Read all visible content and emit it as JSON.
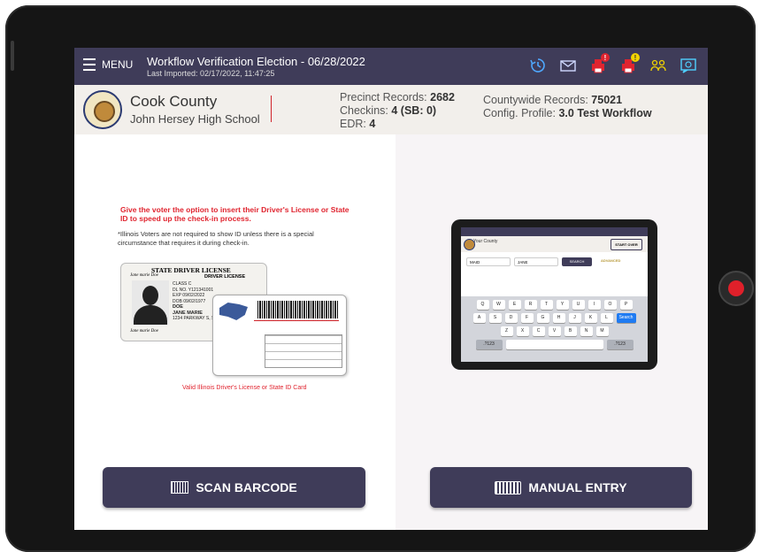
{
  "topbar": {
    "menu_label": "MENU",
    "title": "Workflow Verification Election - 06/28/2022",
    "last_imported": "Last Imported: 02/17/2022, 11:47:25",
    "alert_badge": "!",
    "warning_badge": "!"
  },
  "header": {
    "county": "Cook County",
    "location": "John Hersey High School",
    "precinct_label": "Precinct Records:",
    "precinct_value": "2682",
    "checkins_label": "Checkins:",
    "checkins_value": "4 (SB: 0)",
    "edr_label": "EDR:",
    "edr_value": "4",
    "countywide_label": "Countywide Records:",
    "countywide_value": "75021",
    "config_label": "Config. Profile:",
    "config_value": "3.0 Test Workflow"
  },
  "left_panel": {
    "instruction": "Give the voter the option to insert their Driver's License or State ID to speed up the check-in process.",
    "note": "*Illinois Voters are not required to show ID unless there is a special circumstance that requires it during check-in.",
    "card_title": "STATE DRIVER LICENSE",
    "card_subtitle": "DRIVER LICENSE",
    "card_signature": "Jane marie Doe",
    "card_id": "DL NO. Y121341001",
    "card_class": "CLASS C",
    "card_exp": "EXP 09/02/2022",
    "card_dob": "DOB 09/02/1977",
    "card_lastname": "DOE",
    "card_name": "JANE MARIE",
    "card_address": "1234 PARKWAY S, ST. CITY, STATE 12345",
    "caption": "Valid Illinois Driver's License or State ID Card",
    "scan_button": "SCAN BARCODE"
  },
  "right_panel": {
    "tablet_title": "Your County",
    "tablet_start": "START OVER",
    "tablet_last_field": "MAID",
    "tablet_first_field": "JANE",
    "tablet_search": "SEARCH",
    "tablet_advanced": "ADVANCED",
    "keyboard_row1": [
      "Q",
      "W",
      "E",
      "R",
      "T",
      "Y",
      "U",
      "I",
      "O",
      "P"
    ],
    "keyboard_row2": [
      "A",
      "S",
      "D",
      "F",
      "G",
      "H",
      "J",
      "K",
      "L"
    ],
    "keyboard_row3": [
      "Z",
      "X",
      "C",
      "V",
      "B",
      "N",
      "M"
    ],
    "keyboard_search": "Search",
    "manual_button": "MANUAL ENTRY"
  },
  "colors": {
    "topbar": "#3f3c59",
    "accent_red": "#e0242f",
    "subheader": "#f2efeb",
    "icon_yellow": "#f2d400"
  },
  "icons": [
    "menu-icon",
    "history-icon",
    "mail-icon",
    "printer-alert-icon",
    "printer-warning-icon",
    "users-icon",
    "chat-icon",
    "barcode-icon",
    "keyboard-icon"
  ]
}
